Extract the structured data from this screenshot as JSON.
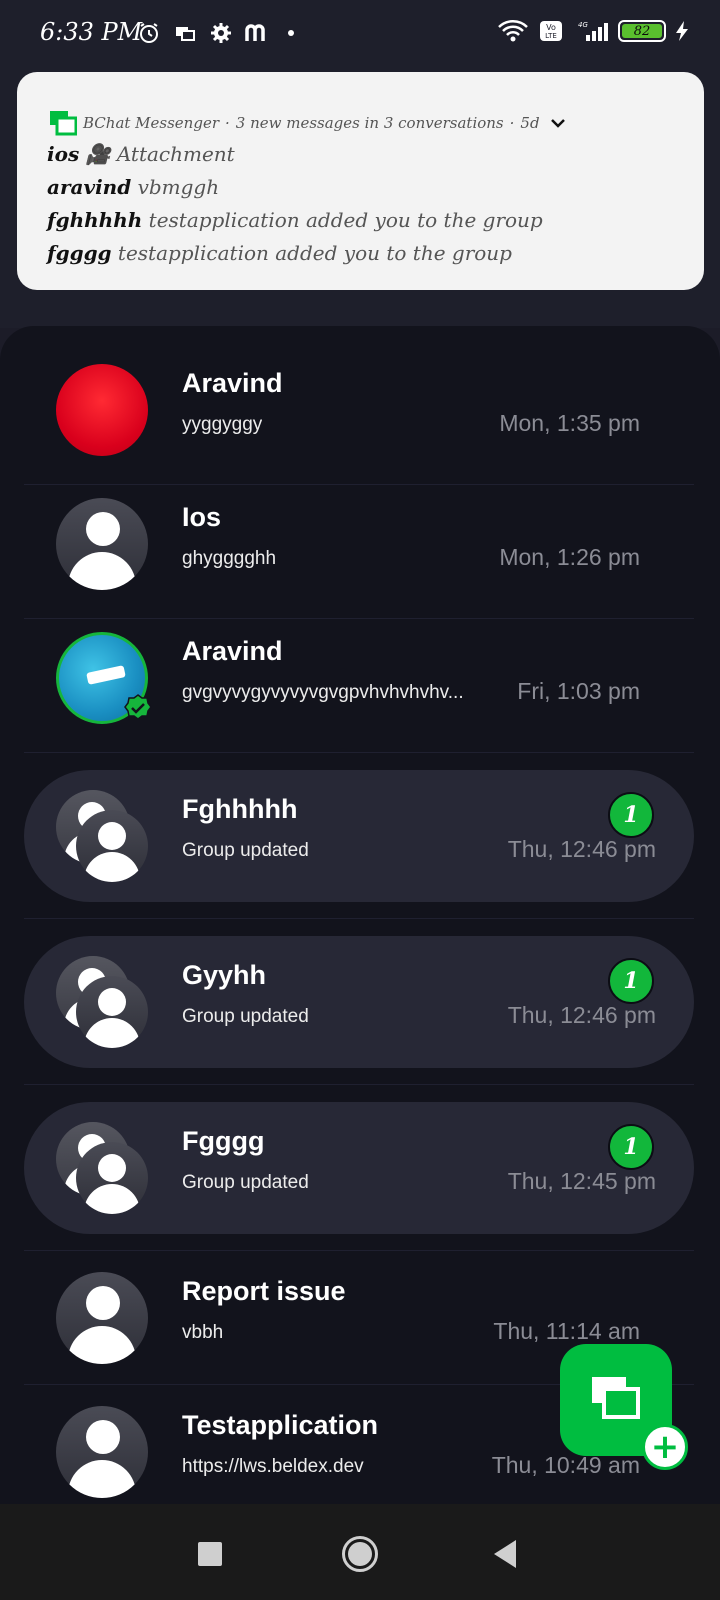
{
  "status_bar": {
    "time": "6:33 PM",
    "icons_left": [
      "alarm-icon",
      "screen-cast-icon",
      "settings-icon",
      "m-app-icon"
    ],
    "network": "4G",
    "volte": "Vo LTE",
    "battery": "82",
    "colors": {
      "battery": "#5ac02e"
    }
  },
  "notification": {
    "app_name": "BChat Messenger",
    "summary": "3 new messages in 3 conversations",
    "age": "5d",
    "separator": "·",
    "lines": [
      {
        "who": "ios",
        "msg": "🎥 Attachment"
      },
      {
        "who": "aravind",
        "msg": "vbmggh"
      },
      {
        "who": "fghhhhh",
        "msg": "testapplication added you to the group"
      },
      {
        "who": "fgggg",
        "msg": "testapplication added you to the group"
      }
    ]
  },
  "conversations": [
    {
      "name": "Aravind",
      "preview": "yyggyggy",
      "time": "Mon, 1:35 pm",
      "avatar": "red",
      "unread": null,
      "highlight": false
    },
    {
      "name": "Ios",
      "preview": "ghygggghh",
      "time": "Mon, 1:26 pm",
      "avatar": "default",
      "unread": null,
      "highlight": false
    },
    {
      "name": "Aravind",
      "preview": "gvgvyvygyvyvyvgvgpvhvhvhvhv...",
      "time": "Fri, 1:03 pm",
      "avatar": "photo-verified",
      "unread": null,
      "highlight": false
    },
    {
      "name": "Fghhhhh",
      "preview": "Group updated",
      "time": "Thu, 12:46 pm",
      "avatar": "group",
      "unread": "1",
      "highlight": true
    },
    {
      "name": "Gyyhh",
      "preview": "Group updated",
      "time": "Thu, 12:46 pm",
      "avatar": "group",
      "unread": "1",
      "highlight": true
    },
    {
      "name": "Fgggg",
      "preview": "Group updated",
      "time": "Thu, 12:45 pm",
      "avatar": "group",
      "unread": "1",
      "highlight": true
    },
    {
      "name": "Report issue",
      "preview": "vbbh",
      "time": "Thu, 11:14 am",
      "avatar": "default",
      "unread": null,
      "highlight": false
    },
    {
      "name": "Testapplication",
      "preview": "https://lws.beldex.dev",
      "time": "Thu, 10:49 am",
      "avatar": "default",
      "unread": null,
      "highlight": false
    }
  ],
  "fab": {
    "icon": "new-chat-icon",
    "plus": "+"
  },
  "nav": {
    "icons": [
      "recents-icon",
      "home-icon",
      "back-icon"
    ]
  },
  "theme": {
    "accent": "#00bd40",
    "panel": "#12131c",
    "highlight_row": "#272836"
  }
}
